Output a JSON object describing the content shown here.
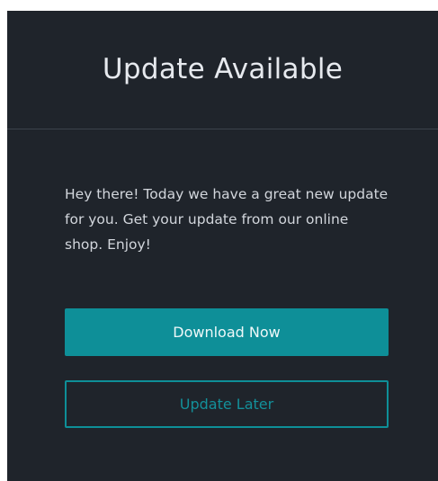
{
  "dialog": {
    "title": "Update Available",
    "message": "Hey there! Today we have a great new update for you. Get your update from our online shop. Enjoy!",
    "primary_button_label": "Download Now",
    "secondary_button_label": "Update Later"
  },
  "colors": {
    "background": "#1f242b",
    "accent": "#0e8f98",
    "title_text": "#e6e9ee",
    "body_text": "#d2d6dc",
    "divider": "#3b424b"
  }
}
